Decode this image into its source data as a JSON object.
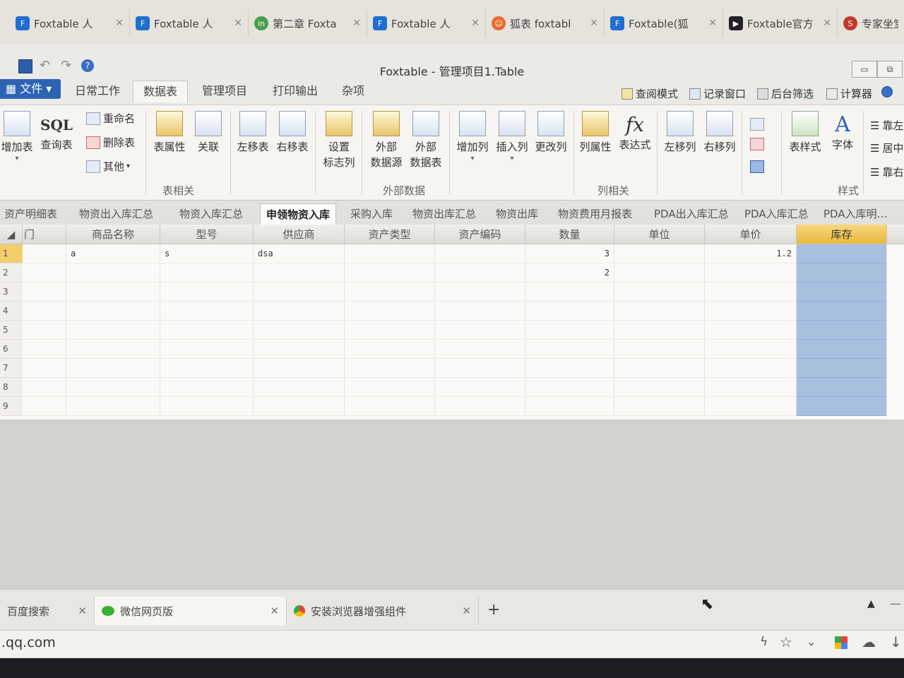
{
  "browser_tabs": [
    {
      "label": "Foxtable 人"
    },
    {
      "label": "Foxtable 人"
    },
    {
      "label": "第二章 Foxta"
    },
    {
      "label": "Foxtable 人"
    },
    {
      "label": "狐表 foxtabl"
    },
    {
      "label": "Foxtable(狐"
    },
    {
      "label": "Foxtable官方"
    },
    {
      "label": "专家坐堂"
    }
  ],
  "window": {
    "title": "Foxtable - 管理项目1.Table"
  },
  "ribbon_tabs": {
    "file": "文件",
    "items": [
      "日常工作",
      "数据表",
      "管理项目",
      "打印输出",
      "杂项"
    ]
  },
  "quick_tools": [
    "查阅模式",
    "记录窗口",
    "后台筛选",
    "计算器"
  ],
  "ribbon": {
    "table_group": {
      "add": "增加表",
      "sql": "SQL",
      "query": "查询表",
      "rename": "重命名",
      "delete": "删除表",
      "other": "其他",
      "props": "表属性",
      "relation": "关联",
      "move_left": "左移表",
      "move_right": "右移表",
      "mark1": "设置",
      "mark2": "标志列",
      "label": "表相关"
    },
    "external": {
      "src1": "外部",
      "src2": "数据源",
      "tbl1": "外部",
      "tbl2": "数据表",
      "label": "外部数据"
    },
    "columns": {
      "add": "增加列",
      "insert": "插入列",
      "change": "更改列",
      "props": "列属性",
      "expr": "表达式",
      "left": "左移列",
      "right": "右移列",
      "fx": "fx",
      "label": "列相关"
    },
    "style": {
      "table_style": "表样式",
      "font": "字体",
      "align_left": "靠左",
      "align_center": "居中",
      "align_right": "靠右",
      "label": "样式"
    }
  },
  "sheet_tabs": [
    "资产明细表",
    "物资出入库汇总",
    "物资入库汇总",
    "申领物资入库",
    "采购入库",
    "物资出库汇总",
    "物资出库",
    "物资费用月报表",
    "PDA出入库汇总",
    "PDA入库汇总",
    "PDA入库明…"
  ],
  "grid": {
    "columns": [
      "门",
      "商品名称",
      "型号",
      "供应商",
      "资产类型",
      "资产编码",
      "数量",
      "单位",
      "单价",
      "库存"
    ],
    "rows": [
      [
        "",
        "a",
        "s",
        "dsa",
        "",
        "",
        "3",
        "",
        "1.2",
        ""
      ],
      [
        "",
        "",
        "",
        "",
        "",
        "",
        "2",
        "",
        "",
        ""
      ],
      [
        "",
        "",
        "",
        "",
        "",
        "",
        "",
        "",
        "",
        ""
      ],
      [
        "",
        "",
        "",
        "",
        "",
        "",
        "",
        "",
        "",
        ""
      ],
      [
        "",
        "",
        "",
        "",
        "",
        "",
        "",
        "",
        "",
        ""
      ],
      [
        "",
        "",
        "",
        "",
        "",
        "",
        "",
        "",
        "",
        ""
      ],
      [
        "",
        "",
        "",
        "",
        "",
        "",
        "",
        "",
        "",
        ""
      ],
      [
        "",
        "",
        "",
        "",
        "",
        "",
        "",
        "",
        "",
        ""
      ],
      [
        "",
        "",
        "",
        "",
        "",
        "",
        "",
        "",
        "",
        ""
      ]
    ],
    "row_numbers": [
      "1",
      "2",
      "3",
      "4",
      "5",
      "6",
      "7",
      "8",
      "9"
    ]
  },
  "bottom_tabs": [
    {
      "label": "百度搜索"
    },
    {
      "label": "微信网页版"
    },
    {
      "label": "安装浏览器增强组件"
    }
  ],
  "new_tab": "+",
  "address": ".qq.com",
  "colors": {
    "accent": "#2d63b5",
    "selected_column": "#a9bfe0",
    "header_selected": "#e8b93c"
  }
}
